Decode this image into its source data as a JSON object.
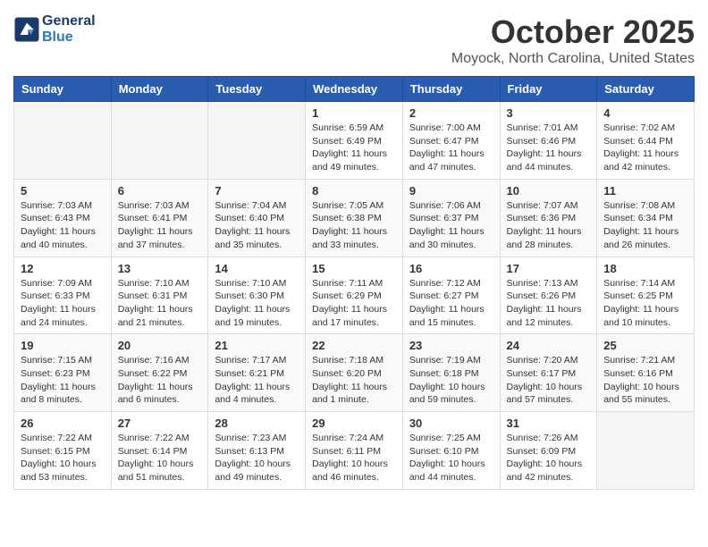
{
  "header": {
    "logo_line1": "General",
    "logo_line2": "Blue",
    "month": "October 2025",
    "location": "Moyock, North Carolina, United States"
  },
  "days_of_week": [
    "Sunday",
    "Monday",
    "Tuesday",
    "Wednesday",
    "Thursday",
    "Friday",
    "Saturday"
  ],
  "weeks": [
    [
      {
        "day": "",
        "info": ""
      },
      {
        "day": "",
        "info": ""
      },
      {
        "day": "",
        "info": ""
      },
      {
        "day": "1",
        "info": "Sunrise: 6:59 AM\nSunset: 6:49 PM\nDaylight: 11 hours and 49 minutes."
      },
      {
        "day": "2",
        "info": "Sunrise: 7:00 AM\nSunset: 6:47 PM\nDaylight: 11 hours and 47 minutes."
      },
      {
        "day": "3",
        "info": "Sunrise: 7:01 AM\nSunset: 6:46 PM\nDaylight: 11 hours and 44 minutes."
      },
      {
        "day": "4",
        "info": "Sunrise: 7:02 AM\nSunset: 6:44 PM\nDaylight: 11 hours and 42 minutes."
      }
    ],
    [
      {
        "day": "5",
        "info": "Sunrise: 7:03 AM\nSunset: 6:43 PM\nDaylight: 11 hours and 40 minutes."
      },
      {
        "day": "6",
        "info": "Sunrise: 7:03 AM\nSunset: 6:41 PM\nDaylight: 11 hours and 37 minutes."
      },
      {
        "day": "7",
        "info": "Sunrise: 7:04 AM\nSunset: 6:40 PM\nDaylight: 11 hours and 35 minutes."
      },
      {
        "day": "8",
        "info": "Sunrise: 7:05 AM\nSunset: 6:38 PM\nDaylight: 11 hours and 33 minutes."
      },
      {
        "day": "9",
        "info": "Sunrise: 7:06 AM\nSunset: 6:37 PM\nDaylight: 11 hours and 30 minutes."
      },
      {
        "day": "10",
        "info": "Sunrise: 7:07 AM\nSunset: 6:36 PM\nDaylight: 11 hours and 28 minutes."
      },
      {
        "day": "11",
        "info": "Sunrise: 7:08 AM\nSunset: 6:34 PM\nDaylight: 11 hours and 26 minutes."
      }
    ],
    [
      {
        "day": "12",
        "info": "Sunrise: 7:09 AM\nSunset: 6:33 PM\nDaylight: 11 hours and 24 minutes."
      },
      {
        "day": "13",
        "info": "Sunrise: 7:10 AM\nSunset: 6:31 PM\nDaylight: 11 hours and 21 minutes."
      },
      {
        "day": "14",
        "info": "Sunrise: 7:10 AM\nSunset: 6:30 PM\nDaylight: 11 hours and 19 minutes."
      },
      {
        "day": "15",
        "info": "Sunrise: 7:11 AM\nSunset: 6:29 PM\nDaylight: 11 hours and 17 minutes."
      },
      {
        "day": "16",
        "info": "Sunrise: 7:12 AM\nSunset: 6:27 PM\nDaylight: 11 hours and 15 minutes."
      },
      {
        "day": "17",
        "info": "Sunrise: 7:13 AM\nSunset: 6:26 PM\nDaylight: 11 hours and 12 minutes."
      },
      {
        "day": "18",
        "info": "Sunrise: 7:14 AM\nSunset: 6:25 PM\nDaylight: 11 hours and 10 minutes."
      }
    ],
    [
      {
        "day": "19",
        "info": "Sunrise: 7:15 AM\nSunset: 6:23 PM\nDaylight: 11 hours and 8 minutes."
      },
      {
        "day": "20",
        "info": "Sunrise: 7:16 AM\nSunset: 6:22 PM\nDaylight: 11 hours and 6 minutes."
      },
      {
        "day": "21",
        "info": "Sunrise: 7:17 AM\nSunset: 6:21 PM\nDaylight: 11 hours and 4 minutes."
      },
      {
        "day": "22",
        "info": "Sunrise: 7:18 AM\nSunset: 6:20 PM\nDaylight: 11 hours and 1 minute."
      },
      {
        "day": "23",
        "info": "Sunrise: 7:19 AM\nSunset: 6:18 PM\nDaylight: 10 hours and 59 minutes."
      },
      {
        "day": "24",
        "info": "Sunrise: 7:20 AM\nSunset: 6:17 PM\nDaylight: 10 hours and 57 minutes."
      },
      {
        "day": "25",
        "info": "Sunrise: 7:21 AM\nSunset: 6:16 PM\nDaylight: 10 hours and 55 minutes."
      }
    ],
    [
      {
        "day": "26",
        "info": "Sunrise: 7:22 AM\nSunset: 6:15 PM\nDaylight: 10 hours and 53 minutes."
      },
      {
        "day": "27",
        "info": "Sunrise: 7:22 AM\nSunset: 6:14 PM\nDaylight: 10 hours and 51 minutes."
      },
      {
        "day": "28",
        "info": "Sunrise: 7:23 AM\nSunset: 6:13 PM\nDaylight: 10 hours and 49 minutes."
      },
      {
        "day": "29",
        "info": "Sunrise: 7:24 AM\nSunset: 6:11 PM\nDaylight: 10 hours and 46 minutes."
      },
      {
        "day": "30",
        "info": "Sunrise: 7:25 AM\nSunset: 6:10 PM\nDaylight: 10 hours and 44 minutes."
      },
      {
        "day": "31",
        "info": "Sunrise: 7:26 AM\nSunset: 6:09 PM\nDaylight: 10 hours and 42 minutes."
      },
      {
        "day": "",
        "info": ""
      }
    ]
  ]
}
